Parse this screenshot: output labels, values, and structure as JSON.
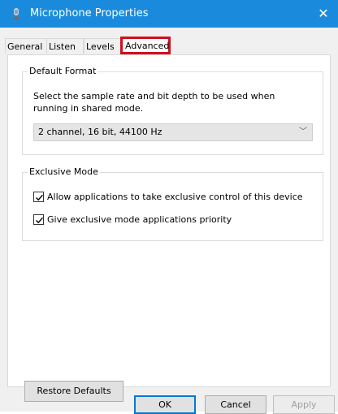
{
  "window": {
    "title": "Microphone Properties",
    "close_glyph": "✕",
    "icon": "microphone-icon",
    "titlebar_color": "#1a8bdc"
  },
  "tabs": [
    {
      "label": "General"
    },
    {
      "label": "Listen"
    },
    {
      "label": "Levels"
    },
    {
      "label": "Advanced",
      "active": true
    }
  ],
  "default_format": {
    "title": "Default Format",
    "description": "Select the sample rate and bit depth to be used when running in shared mode.",
    "selected_format": "2 channel, 16 bit, 44100 Hz",
    "chevron": "﹀"
  },
  "exclusive_mode": {
    "title": "Exclusive Mode",
    "options": [
      {
        "label": "Allow applications to take exclusive control of this device",
        "checked": true
      },
      {
        "label": "Give exclusive mode applications priority",
        "checked": true
      }
    ]
  },
  "buttons": {
    "restore_defaults": "Restore Defaults",
    "ok": "OK",
    "cancel": "Cancel",
    "apply": "Apply"
  },
  "highlight_color": "#d20e1c"
}
